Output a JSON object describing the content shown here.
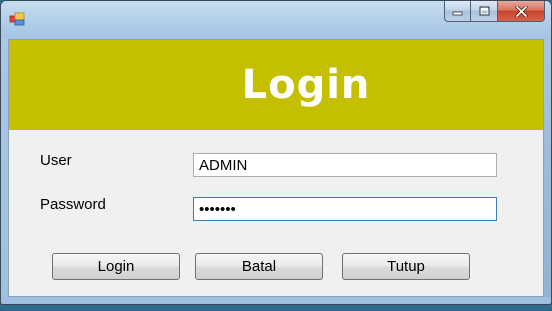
{
  "window": {
    "title": "",
    "icon": "app-form-icon",
    "controls": [
      "minimize-icon",
      "maximize-icon",
      "close-icon"
    ]
  },
  "banner": {
    "title": "Login",
    "color": "#c4c000"
  },
  "form": {
    "user_label": "User",
    "user_value": "ADMIN",
    "password_label": "Password",
    "password_value": "•••••••"
  },
  "buttons": {
    "login": "Login",
    "batal": "Batal",
    "tutup": "Tutup"
  }
}
